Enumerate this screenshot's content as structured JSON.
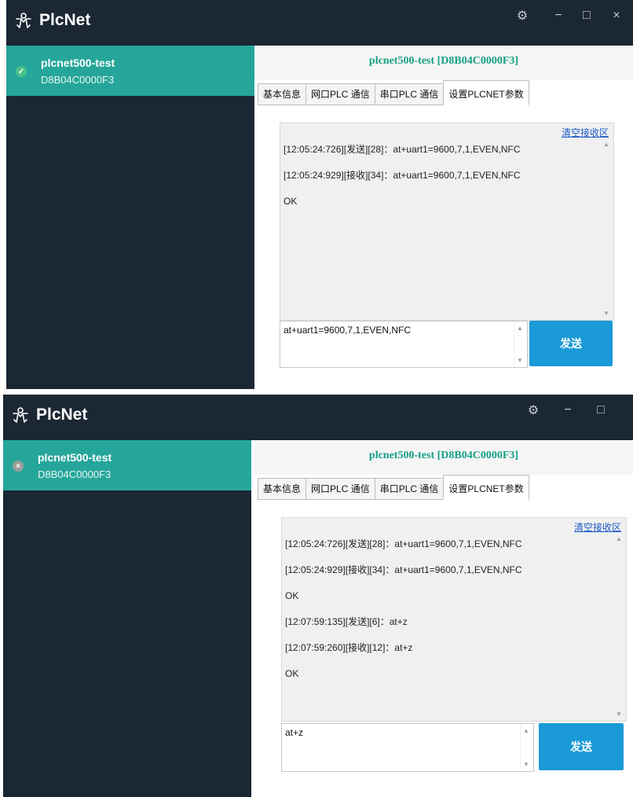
{
  "app": {
    "title": "PlcNet"
  },
  "window_controls": {
    "settings_icon": "gear-icon",
    "minimize": "−",
    "maximize": "□",
    "close": "×"
  },
  "colors": {
    "titlebar": "#1b2733",
    "selected_device": "#26a69a",
    "header_text": "#16a085",
    "send_button": "#1a9ad6"
  },
  "panels": [
    {
      "device": {
        "name": "plcnet500-test",
        "id": "D8B04C0000F3",
        "status": "connected",
        "status_icon": "✓",
        "status_color": "#4cc38a"
      },
      "header": "plcnet500-test  [D8B04C0000F3]",
      "tabs": [
        "基本信息",
        "网口PLC 通信",
        "串口PLC 通信",
        "设置PLCNET参数"
      ],
      "active_tab": 3,
      "clear_label": "清空接收区",
      "log": [
        "[12:05:24:726][发送][28]：at+uart1=9600,7,1,EVEN,NFC",
        "[12:05:24:929][接收][34]：at+uart1=9600,7,1,EVEN,NFC",
        "OK"
      ],
      "input_value": "at+uart1=9600,7,1,EVEN,NFC",
      "send_label": "发送"
    },
    {
      "device": {
        "name": "plcnet500-test",
        "id": "D8B04C0000F3",
        "status": "disconnected",
        "status_icon": "×",
        "status_color": "#9e9e9e"
      },
      "header": "plcnet500-test  [D8B04C0000F3]",
      "tabs": [
        "基本信息",
        "网口PLC 通信",
        "串口PLC 通信",
        "设置PLCNET参数"
      ],
      "active_tab": 3,
      "clear_label": "清空接收区",
      "log": [
        "[12:05:24:726][发送][28]：at+uart1=9600,7,1,EVEN,NFC",
        "[12:05:24:929][接收][34]：at+uart1=9600,7,1,EVEN,NFC",
        "OK",
        "[12:07:59:135][发送][6]：at+z",
        "[12:07:59:260][接收][12]：at+z",
        "OK"
      ],
      "input_value": "at+z",
      "send_label": "发送"
    }
  ]
}
